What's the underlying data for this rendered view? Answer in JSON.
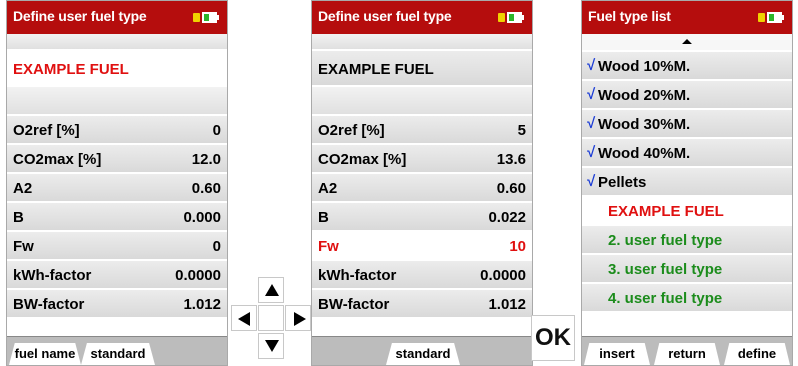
{
  "screen1": {
    "title": "Define user fuel type",
    "fuel_name": "EXAMPLE FUEL",
    "rows": [
      {
        "label": "O2ref [%]",
        "value": "0"
      },
      {
        "label": "CO2max [%]",
        "value": "12.0"
      },
      {
        "label": "A2",
        "value": "0.60"
      },
      {
        "label": "B",
        "value": "0.000"
      },
      {
        "label": "Fw",
        "value": "0"
      },
      {
        "label": "kWh-factor",
        "value": "0.0000"
      },
      {
        "label": "BW-factor",
        "value": "1.012"
      }
    ],
    "tabs": [
      "fuel name",
      "standard"
    ]
  },
  "screen2": {
    "title": "Define user fuel type",
    "fuel_name": "EXAMPLE FUEL",
    "rows": [
      {
        "label": "O2ref [%]",
        "value": "5"
      },
      {
        "label": "CO2max [%]",
        "value": "13.6"
      },
      {
        "label": "A2",
        "value": "0.60"
      },
      {
        "label": "B",
        "value": "0.022"
      },
      {
        "label": "Fw",
        "value": "10"
      },
      {
        "label": "kWh-factor",
        "value": "0.0000"
      },
      {
        "label": "BW-factor",
        "value": "1.012"
      }
    ],
    "tabs": [
      "standard"
    ]
  },
  "screen3": {
    "title": "Fuel type list",
    "items": [
      {
        "label": "Wood 10%M.",
        "check": "√"
      },
      {
        "label": "Wood 20%M.",
        "check": "√"
      },
      {
        "label": "Wood 30%M.",
        "check": "√"
      },
      {
        "label": "Wood 40%M.",
        "check": "√"
      },
      {
        "label": "Pellets",
        "check": "√"
      },
      {
        "label": "EXAMPLE FUEL",
        "check": ""
      },
      {
        "label": "2. user fuel type",
        "check": ""
      },
      {
        "label": "3. user fuel type",
        "check": ""
      },
      {
        "label": "4. user fuel type",
        "check": ""
      }
    ],
    "tabs": [
      "insert",
      "return",
      "define"
    ]
  },
  "keys": {
    "ok_label": "OK"
  },
  "colors": {
    "titlebar": "#b50d0d",
    "highlight_red": "#e01010",
    "user_green": "#1c8c1c",
    "check_blue": "#1a3bd6"
  },
  "icons": [
    "battery-icon",
    "arrow-up-icon",
    "arrow-down-icon",
    "arrow-left-icon",
    "arrow-right-icon",
    "scroll-up-icon"
  ]
}
